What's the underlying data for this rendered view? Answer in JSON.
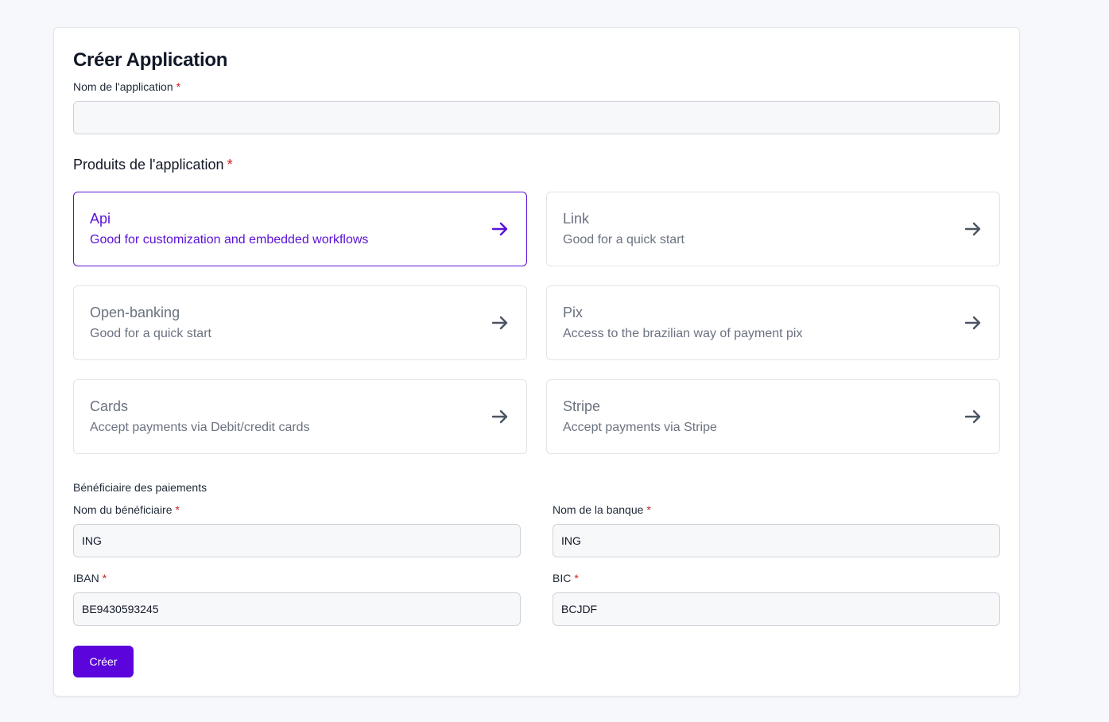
{
  "form": {
    "title": "Créer Application",
    "app_name_label": "Nom de l'application",
    "app_name_value": "",
    "required_mark": "*",
    "products_title": "Produits de l'application",
    "products": [
      {
        "name": "Api",
        "desc": "Good for customization and embedded workflows",
        "selected": true
      },
      {
        "name": "Link",
        "desc": "Good for a quick start",
        "selected": false
      },
      {
        "name": "Open-banking",
        "desc": "Good for a quick start",
        "selected": false
      },
      {
        "name": "Pix",
        "desc": "Access to the brazilian way of payment pix",
        "selected": false
      },
      {
        "name": "Cards",
        "desc": "Accept payments via Debit/credit cards",
        "selected": false
      },
      {
        "name": "Stripe",
        "desc": "Accept payments via Stripe",
        "selected": false
      }
    ],
    "beneficiary_section": "Bénéficiaire des paiements",
    "beneficiary_name_label": "Nom du bénéficiaire",
    "beneficiary_name_value": "ING",
    "bank_name_label": "Nom de la banque",
    "bank_name_value": "ING",
    "iban_label": "IBAN",
    "iban_value": "BE9430593245",
    "bic_label": "BIC",
    "bic_value": "BCJDF",
    "submit_label": "Créer"
  },
  "colors": {
    "accent": "#5b05dc",
    "selected_border": "#5b12d6",
    "required": "#c81e1e",
    "muted_text": "#6b7280"
  },
  "icons": {
    "product_arrow": "arrow-right-icon"
  }
}
